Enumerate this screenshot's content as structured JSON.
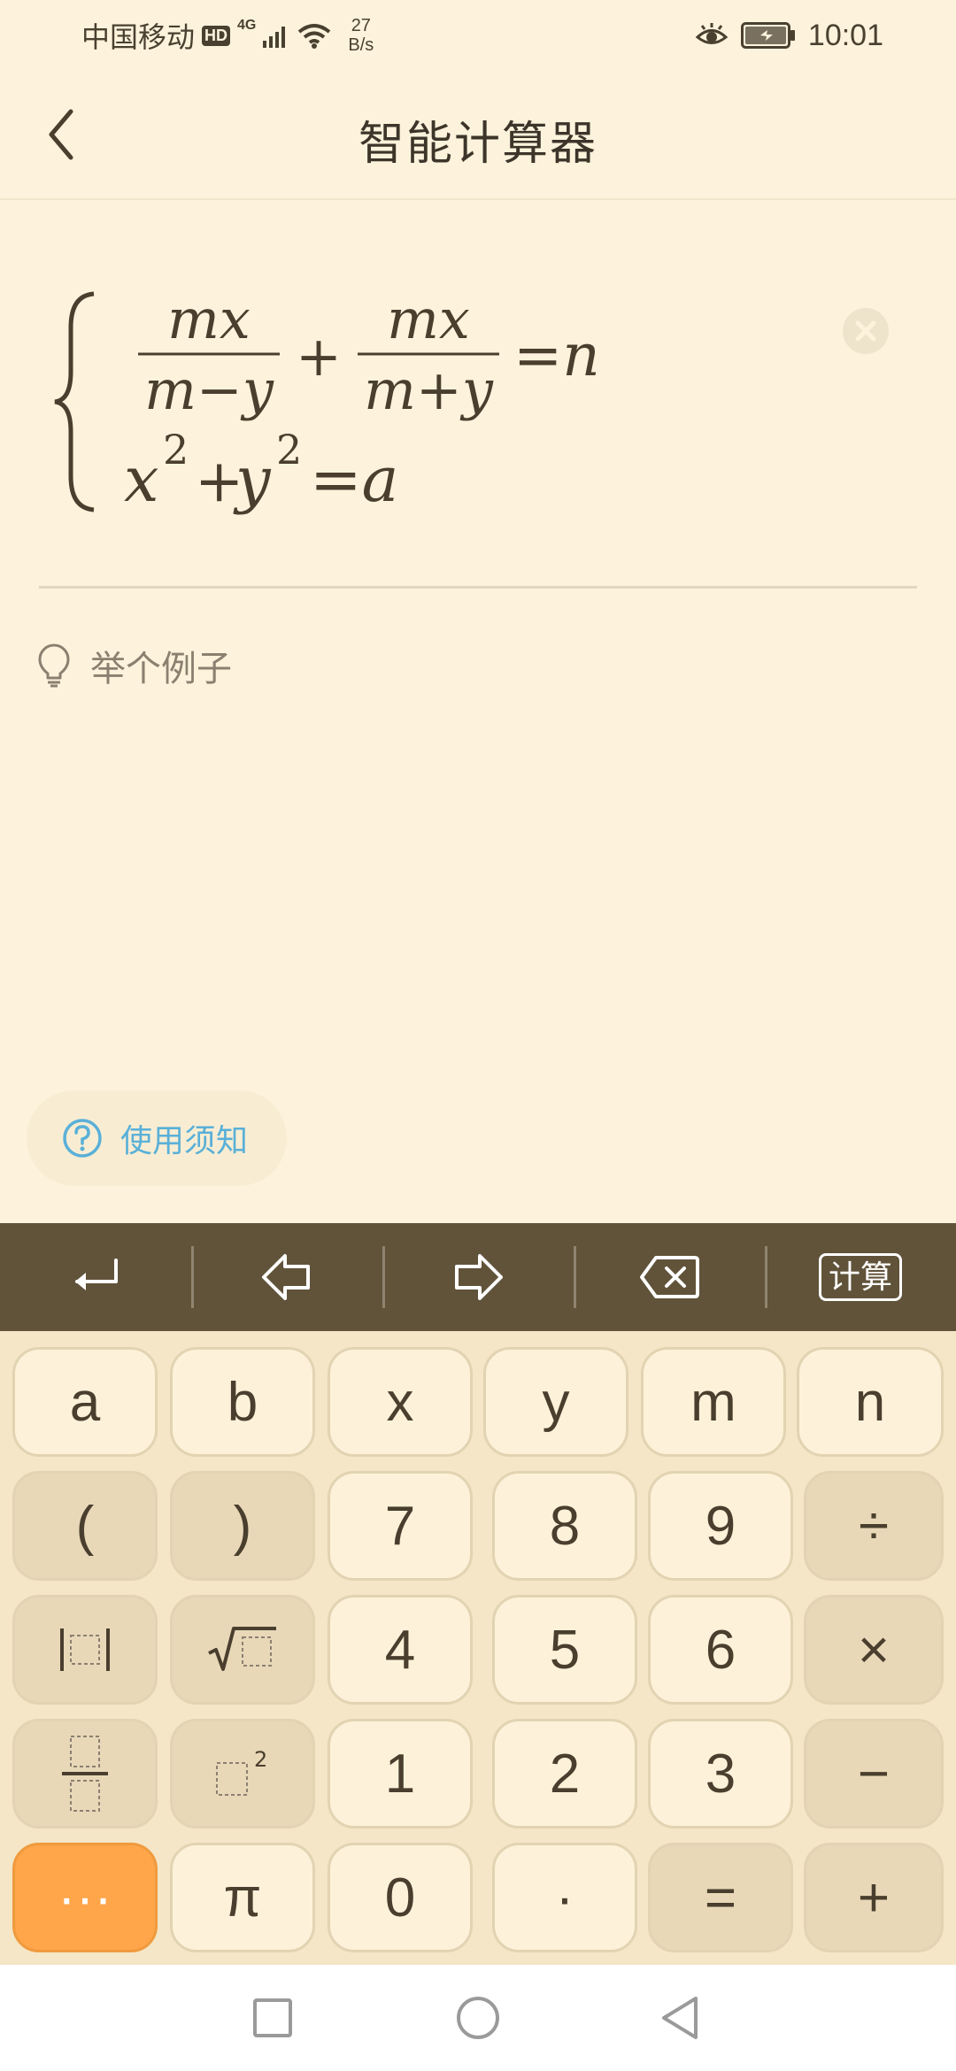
{
  "status_bar": {
    "carrier": "中国移动",
    "hd_badge": "HD",
    "network": "4G",
    "speed_value": "27",
    "speed_unit": "B/s",
    "time": "10:01"
  },
  "header": {
    "title": "智能计算器"
  },
  "formula": {
    "eq1_num_left": "mx",
    "eq1_den_left": "m−y",
    "plus": "+",
    "eq1_num_right": "mx",
    "eq1_den_right": "m+y",
    "eq1_rhs": "=n",
    "eq2_x": "x",
    "eq2_exp1": "2",
    "eq2_plus": "+",
    "eq2_y": "y",
    "eq2_exp2": "2",
    "eq2_rhs": "=a"
  },
  "example": {
    "label": "举个例子"
  },
  "help": {
    "label": "使用须知"
  },
  "toolbar": {
    "calculate_label": "计算"
  },
  "keypad": {
    "a": "a",
    "b": "b",
    "x": "x",
    "y": "y",
    "m": "m",
    "n": "n",
    "lparen": "(",
    "rparen": ")",
    "seven": "7",
    "eight": "8",
    "nine": "9",
    "divide": "÷",
    "four": "4",
    "five": "5",
    "six": "6",
    "multiply": "×",
    "one": "1",
    "two": "2",
    "three": "3",
    "minus": "−",
    "more": "···",
    "pi": "π",
    "zero": "0",
    "dot": "·",
    "equals": "=",
    "plus": "+",
    "square_exp": "2"
  },
  "colors": {
    "background": "#fdf3dc",
    "toolbar": "#61533a",
    "accent_orange": "#ffa54a",
    "help_blue": "#5ab0d8"
  }
}
